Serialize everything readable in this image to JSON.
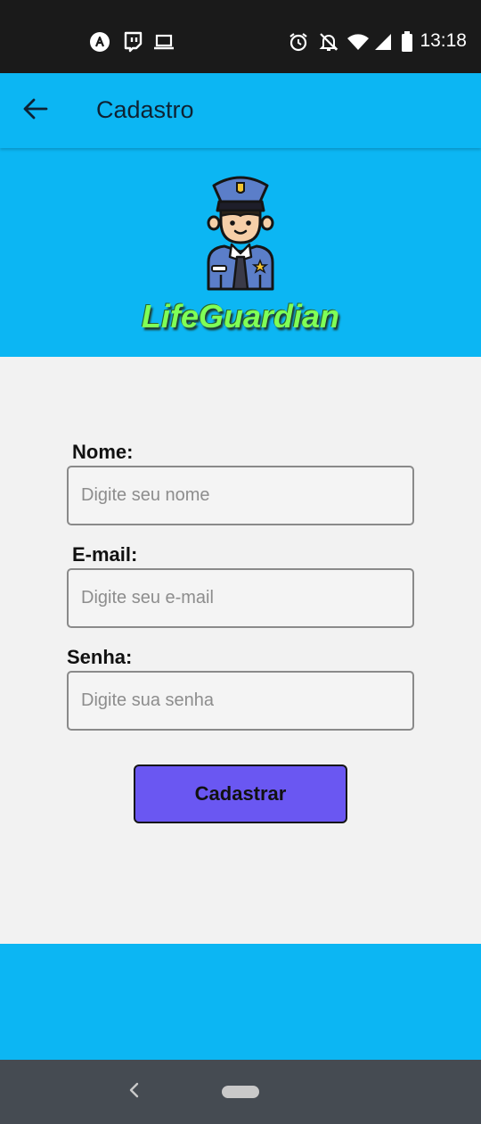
{
  "status_bar": {
    "time": "13:18",
    "left_icons": [
      "app-notification-icon",
      "twitch-icon",
      "laptop-icon"
    ],
    "right_icons": [
      "alarm-icon",
      "notifications-off-icon",
      "wifi-icon",
      "cell-signal-icon",
      "battery-icon"
    ]
  },
  "app_bar": {
    "title": "Cadastro",
    "back_icon": "arrow-left-icon"
  },
  "banner": {
    "logo_name": "LifeGuardian",
    "logo_icon": "police-officer-icon"
  },
  "form": {
    "name_label": "Nome:",
    "name_placeholder": "Digite seu nome",
    "email_label": "E-mail:",
    "email_placeholder": "Digite seu e-mail",
    "password_label": "Senha:",
    "password_placeholder": "Digite sua senha",
    "submit_label": "Cadastrar"
  },
  "colors": {
    "primary": "#0cb6f3",
    "button": "#6a57f2",
    "logo_text": "#7fff57",
    "background": "#f2f2f2"
  },
  "nav_bar": {
    "icons": [
      "nav-back-icon",
      "home-pill-icon"
    ]
  }
}
